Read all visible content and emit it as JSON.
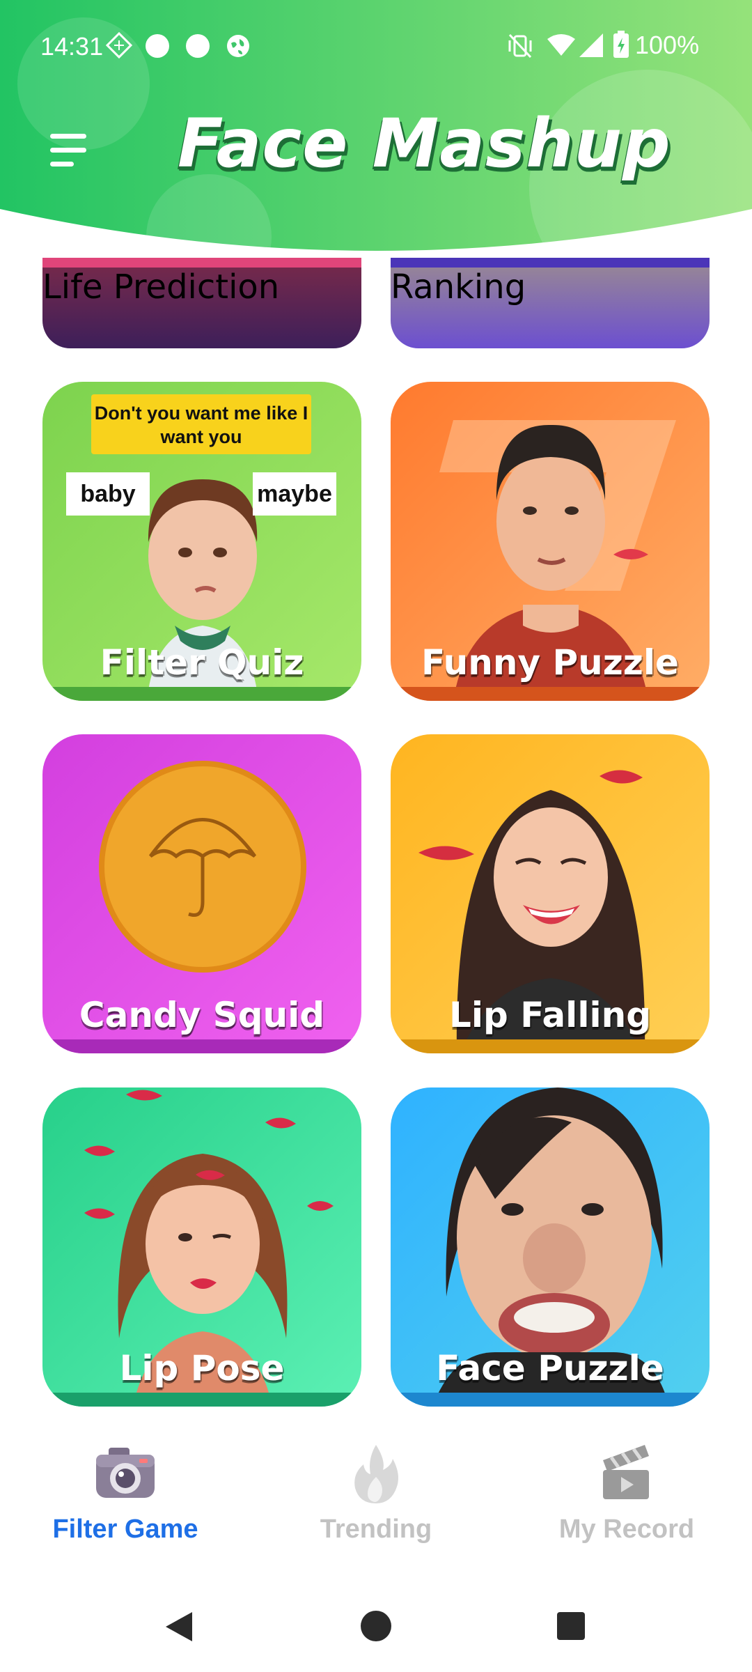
{
  "status_bar": {
    "time": "14:31",
    "battery": "100%"
  },
  "header": {
    "title": "Face Mashup"
  },
  "cards": {
    "life_prediction": "Life Prediction",
    "ranking": "Ranking",
    "filter_quiz": "Filter Quiz",
    "filter_quiz_question": "Don't you want me like I want you",
    "filter_quiz_option_left": "baby",
    "filter_quiz_option_right": "maybe",
    "funny_puzzle": "Funny Puzzle",
    "candy_squid": "Candy Squid",
    "lip_falling": "Lip Falling",
    "lip_pose": "Lip Pose",
    "face_puzzle": "Face Puzzle"
  },
  "bottom_nav": {
    "filter_game": "Filter Game",
    "trending": "Trending",
    "my_record": "My Record"
  },
  "colors": {
    "header_start": "#22c463",
    "header_end": "#8ee06a",
    "nav_active": "#1e6fe6",
    "nav_inactive": "#c2c2c2"
  }
}
